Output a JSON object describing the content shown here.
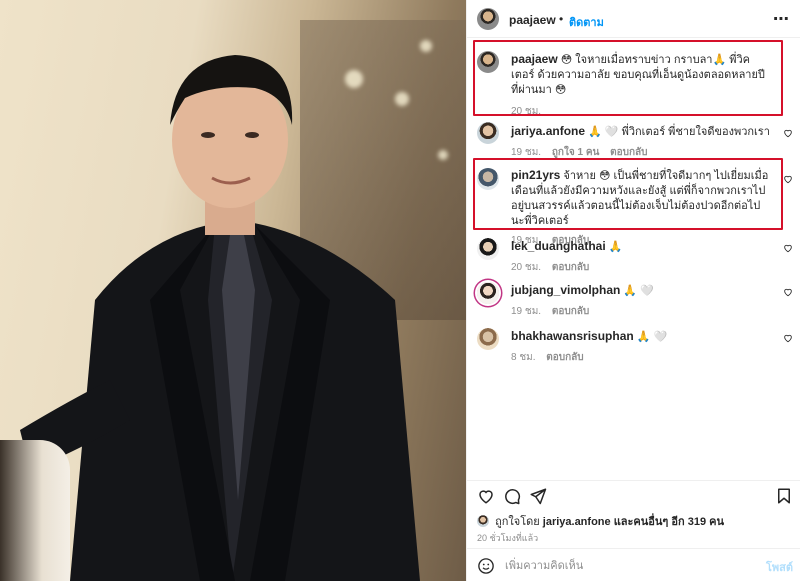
{
  "post": {
    "author": "paajaew",
    "follow_label": "ติดตาม",
    "separator": "•",
    "menu": "⋯"
  },
  "comments": [
    {
      "user": "paajaew",
      "text": "😳 ใจหายเมื่อทราบข่าว กราบลา🙏 พี่วิคเตอร์ ด้วยความอาลัย ขอบคุณที่เอ็นดูน้องตลอดหลายปีที่ผ่านมา 😳",
      "time": "20 ชม.",
      "likes": "",
      "reply": ""
    },
    {
      "user": "jariya.anfone",
      "text": "🙏 🤍 พี่วิกเตอร์ พี่ชายใจดีของพวกเรา",
      "time": "19 ชม.",
      "likes": "ถูกใจ 1 คน",
      "reply": "ตอบกลับ"
    },
    {
      "user": "pin21yrs",
      "text": "จ้าหาย 😳 เป็นพี่ชายที่ใจดีมากๆ ไปเยี่ยมเมื่อเดือนที่แล้วยังมีความหวังและยังสู้ แต่พี่ก็จากพวกเราไปอยู่บนสวรรค์แล้วตอนนี้ไม่ต้องเจ็บไม่ต้องปวดอีกต่อไปนะพี่วิคเตอร์",
      "time": "19 ชม.",
      "likes": "",
      "reply": "ตอบกลับ"
    },
    {
      "user": "lek_duanghathai",
      "text": "🙏",
      "time": "20 ชม.",
      "likes": "",
      "reply": "ตอบกลับ"
    },
    {
      "user": "jubjang_vimolphan",
      "text": "🙏 🤍",
      "time": "19 ชม.",
      "likes": "",
      "reply": "ตอบกลับ"
    },
    {
      "user": "bhakhawansrisuphan",
      "text": "🙏 🤍",
      "time": "8 ชม.",
      "likes": "",
      "reply": "ตอบกลับ"
    }
  ],
  "likes_line": {
    "prefix": "ถูกใจโดย",
    "user": "jariya.anfone",
    "suffix": "และคนอื่นๆ อีก 319 คน"
  },
  "posted_ago": "20 ชั่วโมงที่แล้ว",
  "add_comment": {
    "placeholder": "เพิ่มความคิดเห็น",
    "post_label": "โพสต์"
  },
  "colors": {
    "highlight": "#d5102a",
    "link": "#0095f6",
    "post_disabled": "#b2dffc"
  }
}
